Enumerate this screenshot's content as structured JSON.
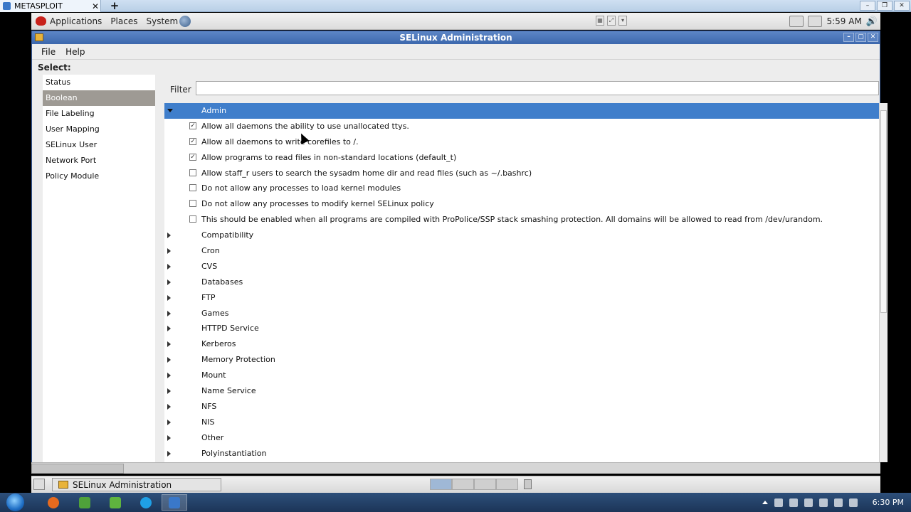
{
  "host_tab": {
    "title": "METASPLOIT",
    "close": "✕",
    "new_tab": "+"
  },
  "gnome_panel": {
    "menus": [
      "Applications",
      "Places",
      "System"
    ],
    "clock": "5:59 AM"
  },
  "window": {
    "title": "SELinux Administration",
    "menu": [
      "File",
      "Help"
    ]
  },
  "sidebar": {
    "label": "Select:",
    "items": [
      {
        "label": "Status",
        "active": false
      },
      {
        "label": "Boolean",
        "active": true
      },
      {
        "label": "File Labeling",
        "active": false
      },
      {
        "label": "User Mapping",
        "active": false
      },
      {
        "label": "SELinux User",
        "active": false
      },
      {
        "label": "Network Port",
        "active": false
      },
      {
        "label": "Policy Module",
        "active": false
      }
    ]
  },
  "filter": {
    "label": "Filter",
    "value": "",
    "placeholder": ""
  },
  "tree": {
    "expanded_group": "Admin",
    "admin_items": [
      {
        "label": "Allow all daemons the ability to use unallocated ttys.",
        "checked": true
      },
      {
        "label": "Allow all daemons to write corefiles to /.",
        "checked": true
      },
      {
        "label": "Allow programs to read files in non-standard locations (default_t)",
        "checked": true
      },
      {
        "label": "Allow staff_r users to search the sysadm home dir and read files (such as ~/.bashrc)",
        "checked": false
      },
      {
        "label": "Do not allow any processes to load kernel modules",
        "checked": false
      },
      {
        "label": "Do not allow any processes to modify kernel SELinux policy",
        "checked": false
      },
      {
        "label": "This should be enabled when all programs are compiled with ProPolice/SSP stack smashing protection.  All domains will be allowed to read from /dev/urandom.",
        "checked": false
      }
    ],
    "collapsed_groups": [
      "Compatibility",
      "Cron",
      "CVS",
      "Databases",
      "FTP",
      "Games",
      "HTTPD Service",
      "Kerberos",
      "Memory Protection",
      "Mount",
      "Name Service",
      "NFS",
      "NIS",
      "Other",
      "Polyinstantiation"
    ]
  },
  "bottom_panel": {
    "task_label": "SELinux Administration"
  },
  "host_taskbar": {
    "clock": "6:30 PM"
  },
  "colors": {
    "selection": "#3f7ecb",
    "title_bar": "#3c68ad",
    "sidebar_active": "#9e9a94"
  }
}
